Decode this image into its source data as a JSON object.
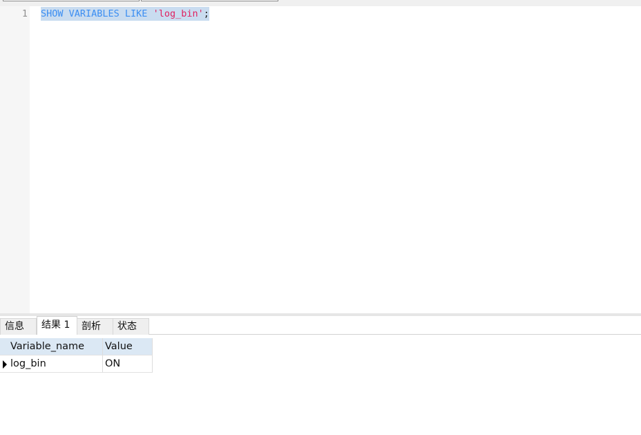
{
  "editor": {
    "line_number": "1",
    "code": {
      "keyword": "SHOW VARIABLES LIKE",
      "space": " ",
      "string": "'log_bin'",
      "terminator": ";"
    }
  },
  "result_tabs": [
    {
      "label": "信息"
    },
    {
      "label": "结果 1"
    },
    {
      "label": "剖析"
    },
    {
      "label": "状态"
    }
  ],
  "active_tab": "结果 1",
  "grid": {
    "columns": [
      "Variable_name",
      "Value"
    ],
    "rows": [
      [
        "log_bin",
        "ON"
      ]
    ]
  },
  "colors": {
    "keyword": "#3b8ef2",
    "string": "#e0205f",
    "selection": "#c9dcf0",
    "header_bg": "#dbe8f4"
  },
  "icons": {
    "current_row": "triangle-right-icon"
  }
}
